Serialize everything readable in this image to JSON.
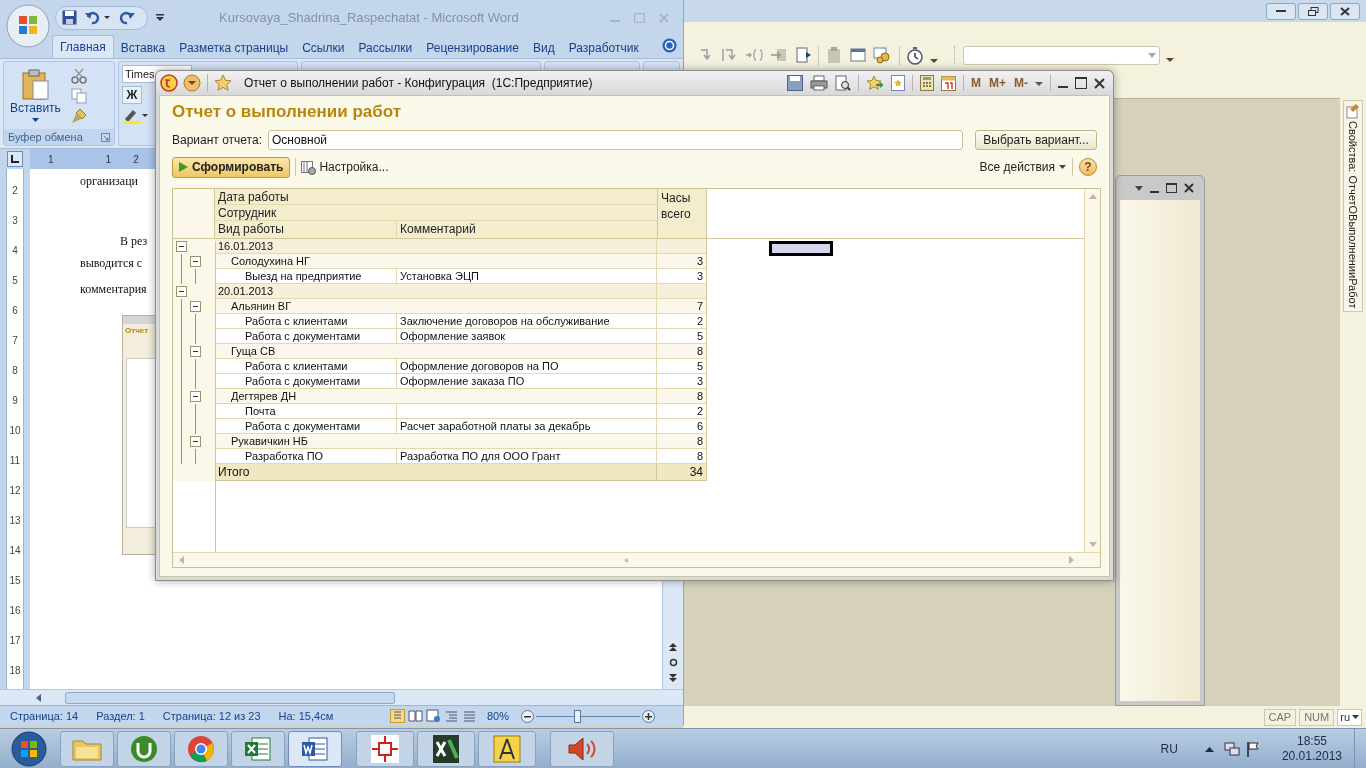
{
  "word": {
    "title": "Kursovaya_Shadrina_Raspechatat - Microsoft Word",
    "tabs": [
      {
        "label": "Главная",
        "selected": true
      },
      {
        "label": "Вставка",
        "selected": false
      },
      {
        "label": "Разметка страницы",
        "selected": false
      },
      {
        "label": "Ссылки",
        "selected": false
      },
      {
        "label": "Рассылки",
        "selected": false
      },
      {
        "label": "Рецензирование",
        "selected": false
      },
      {
        "label": "Вид",
        "selected": false
      },
      {
        "label": "Разработчик",
        "selected": false
      }
    ],
    "ribbon": {
      "paste_label": "Вставить",
      "clipboard_group": "Буфер обмена",
      "font_name": "Times",
      "bold_key": "Ж"
    },
    "ruler": {
      "horizontal": [
        "1",
        "1",
        "2"
      ],
      "vertical": [
        "2",
        "3",
        "4",
        "5",
        "6",
        "7",
        "8",
        "9",
        "10",
        "11",
        "12",
        "13",
        "14",
        "15",
        "16",
        "17",
        "18"
      ]
    },
    "document": {
      "lines": [
        "организаци",
        "В рез",
        "выводится с",
        "комментария"
      ],
      "thumbnail_title": "Отчет"
    },
    "status_bar": {
      "items": [
        "Страница: 14",
        "Раздел: 1",
        "Страница: 12 из 23",
        "На: 15,4см"
      ],
      "zoom": "80%",
      "zoom_slider": {
        "level": 0.39
      }
    }
  },
  "main_app": {
    "side_panel": "Свойства: ОтчетОВыполненииРабот",
    "status": [
      "CAP",
      "NUM"
    ],
    "language": "ru"
  },
  "report_window": {
    "title": "Отчет о выполнении работ - Конфигурация  (1С:Предприятие)",
    "memory_buttons": [
      "M",
      "M+",
      "M-"
    ],
    "heading": "Отчет о выполнении работ",
    "variant_label": "Вариант отчета:",
    "variant_value": "Основной",
    "choose_button": "Выбрать вариант...",
    "generate_button": "Сформировать",
    "settings_button": "Настройка...",
    "all_actions": "Все действия",
    "help": "?",
    "table": {
      "header": {
        "date": "Дата работы",
        "employee": "Сотрудник",
        "work": "Вид работы",
        "comment": "Комментарий",
        "hours": "Часы всего"
      },
      "groups": [
        {
          "date": "16.01.2013",
          "expanded": true,
          "children": [
            {
              "employee": "Солодухина НГ",
              "hours": "3",
              "expanded": true,
              "children": [
                {
                  "work": "Выезд на предприятие",
                  "comment": "Установка ЭЦП",
                  "hours": "3"
                }
              ]
            }
          ]
        },
        {
          "date": "20.01.2013",
          "expanded": true,
          "children": [
            {
              "employee": "Альянин ВГ",
              "hours": "7",
              "expanded": true,
              "children": [
                {
                  "work": "Работа с клиентами",
                  "comment": "Заключение договоров на обслуживание",
                  "hours": "2"
                },
                {
                  "work": "Работа с документами",
                  "comment": "Оформление заявок",
                  "hours": "5"
                }
              ]
            },
            {
              "employee": "Гуща СВ",
              "hours": "8",
              "expanded": true,
              "children": [
                {
                  "work": "Работа с клиентами",
                  "comment": "Оформление договоров на ПО",
                  "hours": "5"
                },
                {
                  "work": "Работа с документами",
                  "comment": "Оформление заказа ПО",
                  "hours": "3"
                }
              ]
            },
            {
              "employee": "Дегтярев ДН",
              "hours": "8",
              "expanded": true,
              "children": [
                {
                  "work": "Почта",
                  "hours": "2"
                },
                {
                  "work": "Работа с документами",
                  "comment": "Расчет заработной платы за декабрь",
                  "hours": "6"
                }
              ]
            },
            {
              "employee": "Рукавичкин НБ",
              "hours": "8",
              "expanded": true,
              "children": [
                {
                  "work": "Разработка ПО",
                  "comment": "Разработка ПО для ООО Грант",
                  "hours": "8"
                }
              ]
            }
          ]
        }
      ],
      "total": {
        "label": "Итого",
        "hours": "34"
      }
    }
  },
  "taskbar": {
    "language": "RU",
    "time": "18:55",
    "date": "20.01.2013"
  }
}
